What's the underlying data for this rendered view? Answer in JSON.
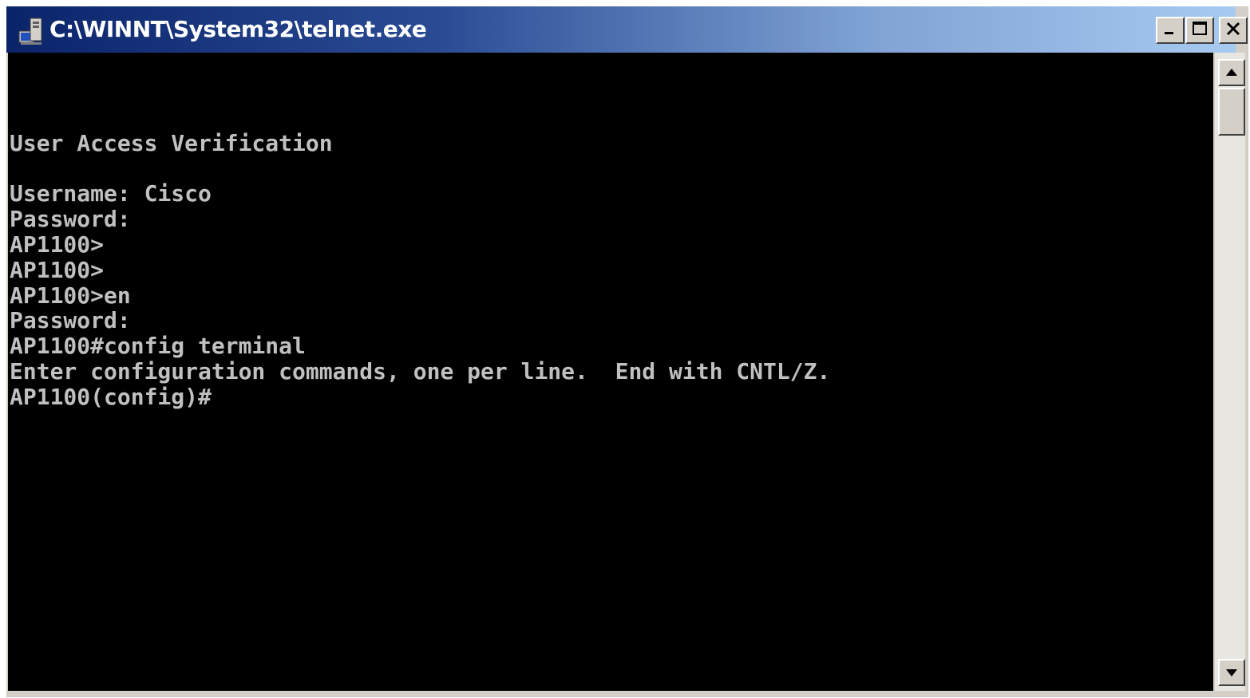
{
  "window": {
    "title": "C:\\WINNT\\System32\\telnet.exe",
    "icon": "console-window-icon",
    "controls": {
      "minimize_icon": "minimize-icon",
      "maximize_icon": "maximize-icon",
      "close_icon": "close-icon"
    }
  },
  "console": {
    "lines": [
      "",
      "User Access Verification",
      "",
      "Username: Cisco",
      "Password:",
      "AP1100>",
      "AP1100>",
      "AP1100>en",
      "Password:",
      "AP1100#config terminal",
      "Enter configuration commands, one per line.  End with CNTL/Z.",
      "AP1100(config)#"
    ],
    "background": "#000000",
    "foreground": "#c0c0c0"
  },
  "scrollbar": {
    "up_icon": "scroll-up-arrow-icon",
    "down_icon": "scroll-down-arrow-icon"
  },
  "colors": {
    "titlebar_start": "#0a246a",
    "titlebar_end": "#a6caf0",
    "chrome": "#d4d0c8"
  }
}
